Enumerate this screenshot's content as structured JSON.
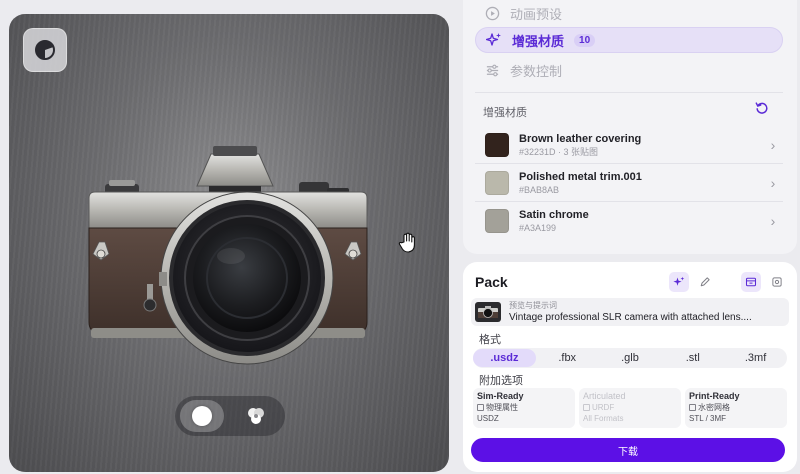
{
  "nav": {
    "items": [
      {
        "label": "动画预设",
        "icon": "play-circle-icon",
        "badge": ""
      },
      {
        "label": "增强材质",
        "icon": "sparkles-icon",
        "badge": "10"
      },
      {
        "label": "参数控制",
        "icon": "sliders-icon",
        "badge": ""
      }
    ]
  },
  "materials": {
    "section_title": "增强材质",
    "items": [
      {
        "name": "Brown leather covering",
        "sub": "#32231D · 3 张贴图",
        "color": "#32231D"
      },
      {
        "name": "Polished metal trim.001",
        "sub": "#BAB8AB",
        "color": "#BAB8AB"
      },
      {
        "name": "Satin chrome",
        "sub": "#A3A199",
        "color": "#A3A199"
      }
    ]
  },
  "pack": {
    "title": "Pack",
    "prompt_label": "预览与提示词",
    "prompt_text": "Vintage professional SLR camera with attached lens....",
    "format_label": "格式",
    "formats": [
      ".usdz",
      ".fbx",
      ".glb",
      ".stl",
      ".3mf"
    ],
    "selected_format": ".usdz",
    "options_label": "附加选项",
    "options": [
      {
        "title": "Sim-Ready",
        "check": "物理属性",
        "foot": "USDZ",
        "disabled": false
      },
      {
        "title": "Articulated",
        "check": "URDF",
        "foot": "All Formats",
        "disabled": true
      },
      {
        "title": "Print-Ready",
        "check": "水密网格",
        "foot": "STL / 3MF",
        "disabled": false
      }
    ],
    "download_label": "下载"
  },
  "colors": {
    "accent": "#5C10E6",
    "accent_soft": "#E6E0F7"
  }
}
